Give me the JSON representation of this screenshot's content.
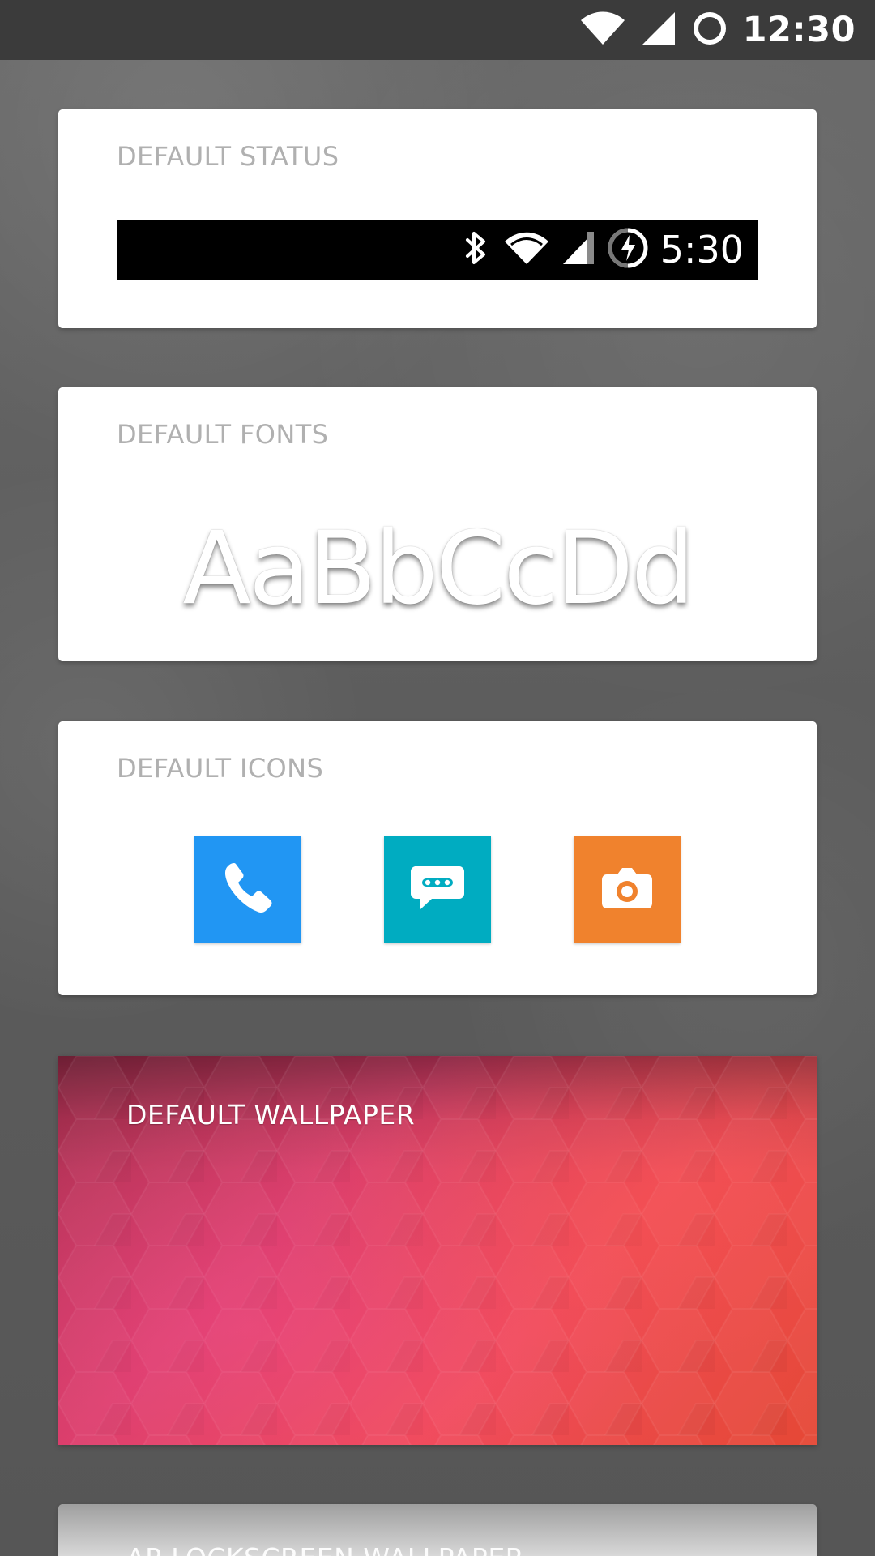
{
  "status_bar": {
    "time": "12:30",
    "icons": [
      "wifi-icon",
      "cellular-signal-icon",
      "circle-status-icon"
    ]
  },
  "cards": {
    "status": {
      "title": "DEFAULT STATUS",
      "preview": {
        "time": "5:30",
        "icons": [
          "bluetooth-icon",
          "wifi-icon",
          "cellular-signal-icon",
          "battery-charging-icon"
        ]
      }
    },
    "fonts": {
      "title": "DEFAULT FONTS",
      "sample": "AaBbCcDd"
    },
    "icons": {
      "title": "DEFAULT ICONS",
      "items": [
        {
          "name": "phone-icon",
          "color": "#2196F3"
        },
        {
          "name": "message-icon",
          "color": "#00ACC1"
        },
        {
          "name": "camera-icon",
          "color": "#F0822D"
        }
      ]
    },
    "wallpaper": {
      "title": "DEFAULT WALLPAPER",
      "colors": [
        "#A82F50",
        "#D93D68",
        "#EF4B57",
        "#E54835"
      ]
    },
    "next": {
      "title": "AP-LOCKSCREEN-WALLPAPER"
    }
  }
}
